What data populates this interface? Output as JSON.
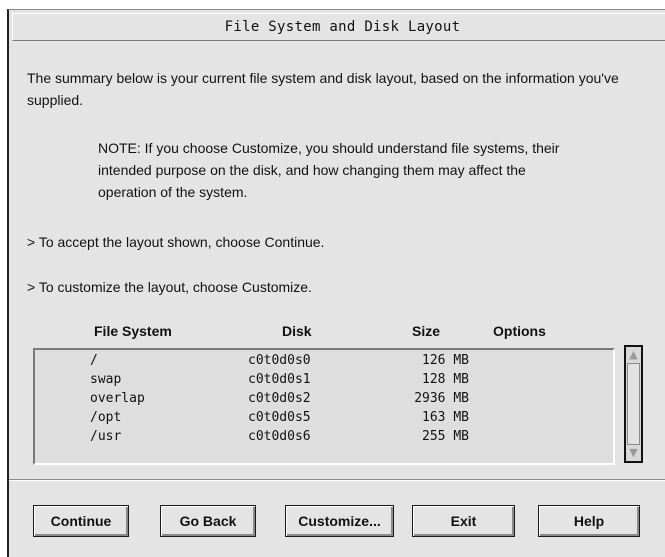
{
  "window": {
    "title": "File System and Disk Layout"
  },
  "content": {
    "summary": "The summary below is your current file system and disk layout, based on the information you've supplied.",
    "note": "NOTE: If you choose Customize, you should understand file systems, their intended purpose on the disk, and how changing them may affect the operation of the system.",
    "accept": "> To accept the layout shown, choose Continue.",
    "customize": "> To customize the layout, choose Customize."
  },
  "table": {
    "headers": {
      "fs": "File System",
      "disk": "Disk",
      "size": "Size",
      "options": "Options"
    },
    "rows": [
      {
        "fs": "/",
        "disk": "c0t0d0s0",
        "size": "126 MB"
      },
      {
        "fs": "swap",
        "disk": "c0t0d0s1",
        "size": "128 MB"
      },
      {
        "fs": "overlap",
        "disk": "c0t0d0s2",
        "size": "2936 MB"
      },
      {
        "fs": "/opt",
        "disk": "c0t0d0s5",
        "size": "163 MB"
      },
      {
        "fs": "/usr",
        "disk": "c0t0d0s6",
        "size": "255 MB"
      }
    ]
  },
  "scrollbar": {
    "up_icon": "triangle-up-icon",
    "down_icon": "triangle-down-icon"
  },
  "buttons": {
    "continue": "Continue",
    "go_back": "Go Back",
    "customize": "Customize...",
    "exit": "Exit",
    "help": "Help"
  }
}
